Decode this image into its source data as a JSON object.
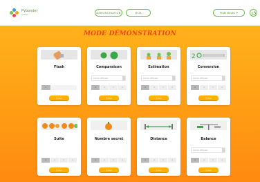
{
  "header": {
    "brand": "Pybonder",
    "brand_sub": "édition",
    "tabs": [
      {
        "label": "DÉMONSTRATION"
      },
      {
        "label": "JEUX"
      }
    ],
    "user_label": "Profil élèves",
    "user_icon": "chevron-down-icon",
    "power_icon": "power-icon"
  },
  "main": {
    "title": "MODE DÉMONSTRATION"
  },
  "select_placeholder": "Choisir difficulté",
  "levels": [
    "1",
    "2",
    "3",
    "4"
  ],
  "start_label": "Entrer",
  "games": [
    {
      "name": "Flash",
      "icon": "hand-pointing-icon"
    },
    {
      "name": "Comparaison",
      "icon": "green-circles-icon"
    },
    {
      "name": "Estimation",
      "icon": "plants-icon"
    },
    {
      "name": "Conversion",
      "icon": "number-ruler-icon"
    },
    {
      "name": "Suite",
      "icon": "orange-sequence-icon"
    },
    {
      "name": "Nombre secret",
      "icon": "mystery-fruit-icon"
    },
    {
      "name": "Distance",
      "icon": "distance-arrow-icon"
    },
    {
      "name": "Balance",
      "icon": "balance-scale-icon"
    }
  ],
  "colors": {
    "accent": "#6cc24a",
    "title": "#e8480c",
    "background": "#ffa21a",
    "button": "#ffb000"
  }
}
